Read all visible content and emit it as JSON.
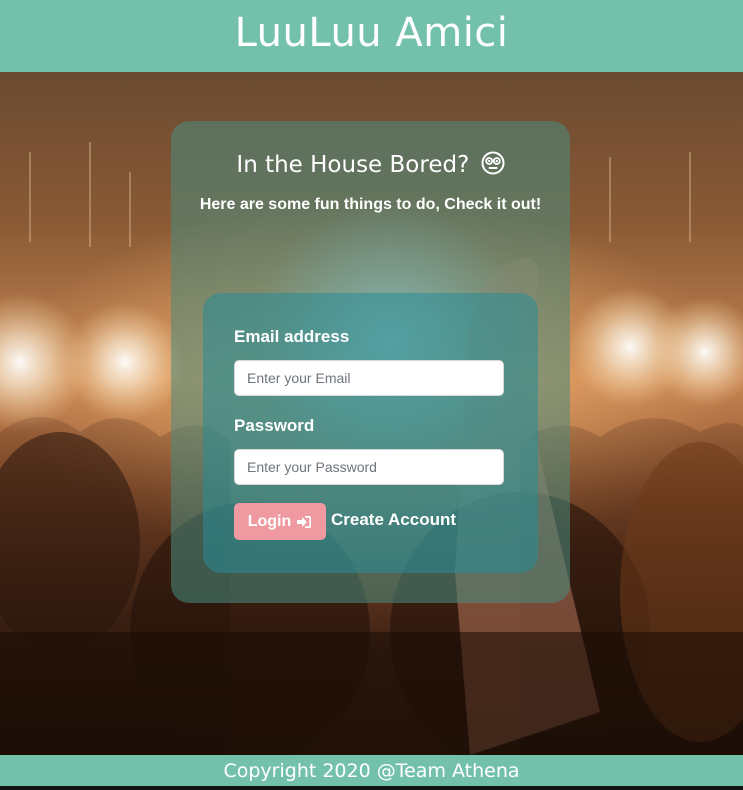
{
  "header": {
    "brand": "LuuLuu Amici"
  },
  "card": {
    "title": "In the House Bored?",
    "title_icon": "flushed-face-icon",
    "subtitle": "Here are some fun things to do, Check it out!"
  },
  "form": {
    "email_label": "Email address",
    "email_placeholder": "Enter your Email",
    "email_value": "",
    "password_label": "Password",
    "password_placeholder": "Enter your Password",
    "password_value": "",
    "login_label": "Login",
    "login_icon": "sign-in-icon",
    "create_account_label": "Create Account"
  },
  "footer": {
    "copyright": "Copyright 2020 @Team Athena"
  },
  "colors": {
    "header_bg": "#73c1ab",
    "footer_bg": "#73c1ab",
    "login_button": "#ef9aa1",
    "card_bg": "rgba(72,140,128,0.55)",
    "panel_bg": "rgba(40,140,150,0.55)"
  },
  "background": {
    "scene": "concert-crowd-photo"
  }
}
